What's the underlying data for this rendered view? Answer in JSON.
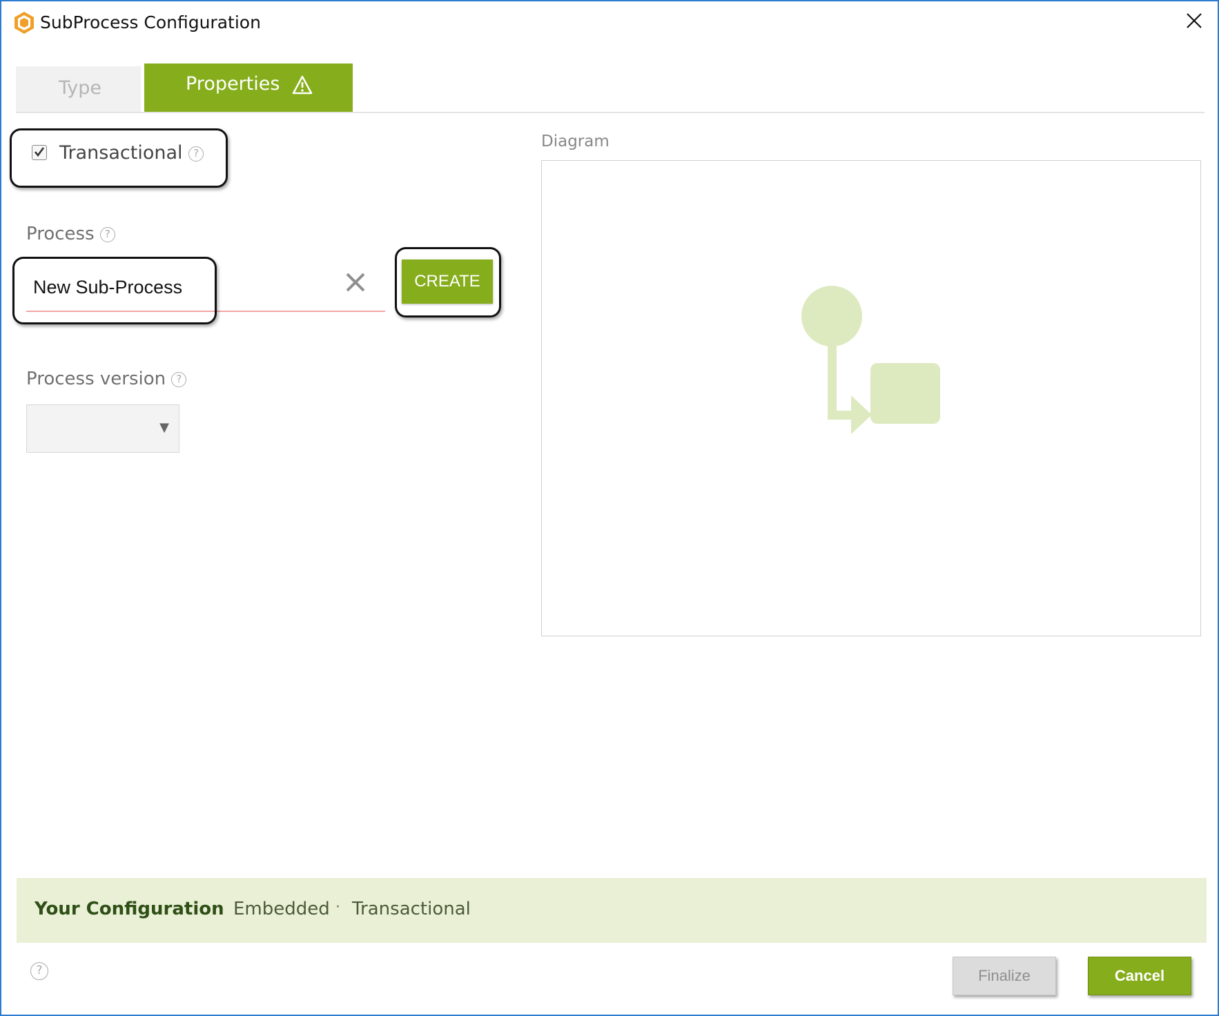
{
  "window": {
    "title": "SubProcess Configuration"
  },
  "icons": {
    "app": "subprocess-app-icon",
    "close": "close-icon",
    "warning": "warning-icon",
    "help": "help-icon",
    "clear": "clear-icon",
    "dropdown": "dropdown-arrow-icon"
  },
  "tabs": [
    {
      "label": "Type",
      "active": false
    },
    {
      "label": "Properties",
      "active": true,
      "warning": true
    }
  ],
  "form": {
    "transactional": {
      "label": "Transactional",
      "checked": true,
      "help": "?"
    },
    "process": {
      "label": "Process",
      "help": "?",
      "value": "New Sub-Process",
      "create_label": "CREATE"
    },
    "version": {
      "label": "Process version",
      "help": "?",
      "selected": "",
      "arrow": "▼"
    }
  },
  "diagram": {
    "label": "Diagram"
  },
  "config": {
    "title": "Your Configuration",
    "separator": "·",
    "items": [
      "Embedded",
      "Transactional"
    ]
  },
  "footer": {
    "help": "?",
    "finalize_label": "Finalize",
    "cancel_label": "Cancel"
  },
  "colors": {
    "accent": "#86ad1b",
    "window_border": "#2b7bd0",
    "config_bg": "#e9f0d6",
    "diagram_shape": "#dde9bf"
  }
}
